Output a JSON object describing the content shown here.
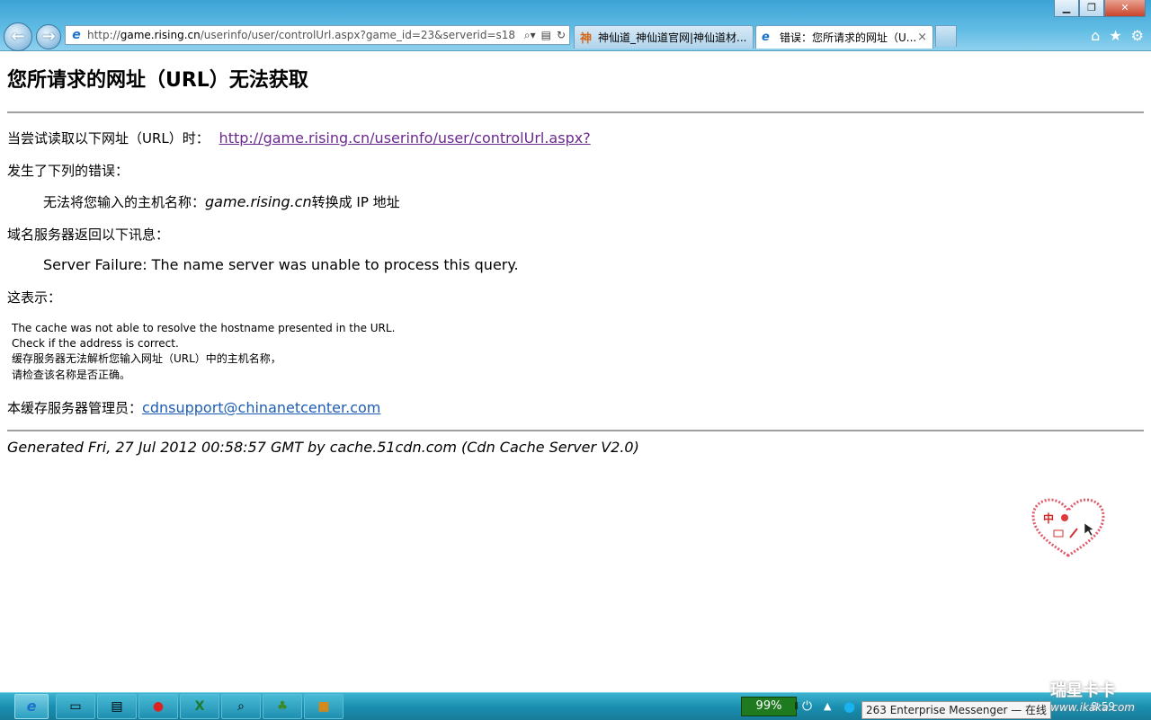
{
  "browser": {
    "address": {
      "prefix": "http://",
      "host": "game.rising.cn",
      "path": "/userinfo/user/controlUrl.aspx?game_id=23&serverid=s18"
    },
    "tabs": [
      {
        "label": "神仙道_神仙道官网|神仙道材...",
        "icon": "game-favicon"
      },
      {
        "label": "错误：您所请求的网址（U...",
        "icon": "ie-favicon",
        "close": "×"
      }
    ],
    "window_buttons": {
      "minimize": "▁",
      "restore": "❐",
      "close": "✕"
    },
    "tools": {
      "home": "⌂",
      "favorites": "★",
      "settings": "⚙"
    }
  },
  "page": {
    "title": "您所请求的网址（URL）无法获取",
    "attempt_label": "当尝试读取以下网址（URL）时：",
    "attempt_url": "http://game.rising.cn/userinfo/user/controlUrl.aspx?",
    "error_label": "发生了下列的错误：",
    "error_prefix": "无法将您输入的主机名称：",
    "error_host": "game.rising.cn",
    "error_suffix": "转换成 IP 地址",
    "dns_label": "域名服务器返回以下讯息：",
    "dns_message": "Server Failure: The name server was unable to process this query.",
    "meaning_label": "这表示：",
    "explain": [
      "The cache was not able to resolve the hostname presented in the URL.",
      "Check if the address is correct.",
      "缓存服务器无法解析您输入网址（URL）中的主机名称，",
      "请检查该名称是否正确。"
    ],
    "admin_label": "本缓存服务器管理员：",
    "admin_email": "cdnsupport@chinanetcenter.com",
    "footer": "Generated Fri, 27 Jul 2012 00:58:57 GMT by cache.51cdn.com (Cdn Cache Server V2.0)"
  },
  "taskbar": {
    "battery": "99%",
    "tray_message": "263 Enterprise Messenger — 在线",
    "clock": "8:59"
  },
  "watermark": {
    "title": "瑞星卡卡",
    "url": "www.ikaka.com"
  },
  "colors": {
    "visited_link": "#6b2a8e",
    "mail_link": "#1d5db5",
    "rule": "#a0a0a0"
  }
}
